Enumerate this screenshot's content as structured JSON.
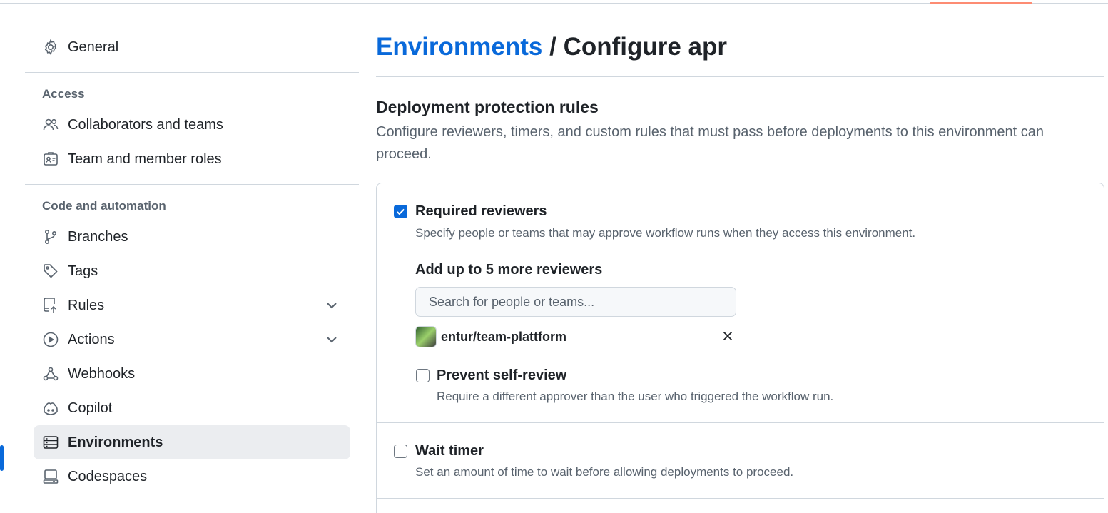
{
  "sidebar": {
    "general": {
      "label": "General",
      "icon": "gear-icon"
    },
    "access_title": "Access",
    "access_items": [
      {
        "label": "Collaborators and teams",
        "icon": "people-icon"
      },
      {
        "label": "Team and member roles",
        "icon": "id-badge-icon"
      }
    ],
    "code_title": "Code and automation",
    "code_items": [
      {
        "label": "Branches",
        "icon": "git-branch-icon"
      },
      {
        "label": "Tags",
        "icon": "tag-icon"
      },
      {
        "label": "Rules",
        "icon": "repo-push-icon",
        "expandable": true
      },
      {
        "label": "Actions",
        "icon": "play-icon",
        "expandable": true
      },
      {
        "label": "Webhooks",
        "icon": "webhook-icon"
      },
      {
        "label": "Copilot",
        "icon": "copilot-icon"
      },
      {
        "label": "Environments",
        "icon": "server-icon",
        "active": true
      },
      {
        "label": "Codespaces",
        "icon": "codespaces-icon"
      }
    ]
  },
  "main": {
    "breadcrumb_link": "Environments",
    "breadcrumb_sep": " / ",
    "breadcrumb_current": "Configure apr",
    "section_title": "Deployment protection rules",
    "section_desc": "Configure reviewers, timers, and custom rules that must pass before deployments to this environment can proceed.",
    "required_reviewers": {
      "checked": true,
      "title": "Required reviewers",
      "desc": "Specify people or teams that may approve workflow runs when they access this environment.",
      "add_title": "Add up to 5 more reviewers",
      "search_placeholder": "Search for people or teams...",
      "reviewer": "entur/team-plattform",
      "prevent_self_review": {
        "checked": false,
        "title": "Prevent self-review",
        "desc": "Require a different approver than the user who triggered the workflow run."
      }
    },
    "wait_timer": {
      "checked": false,
      "title": "Wait timer",
      "desc": "Set an amount of time to wait before allowing deployments to proceed."
    }
  },
  "colors": {
    "accent": "#0969da",
    "tab_underline": "#fd8c73",
    "muted": "#59636e",
    "border": "#d0d7de"
  }
}
